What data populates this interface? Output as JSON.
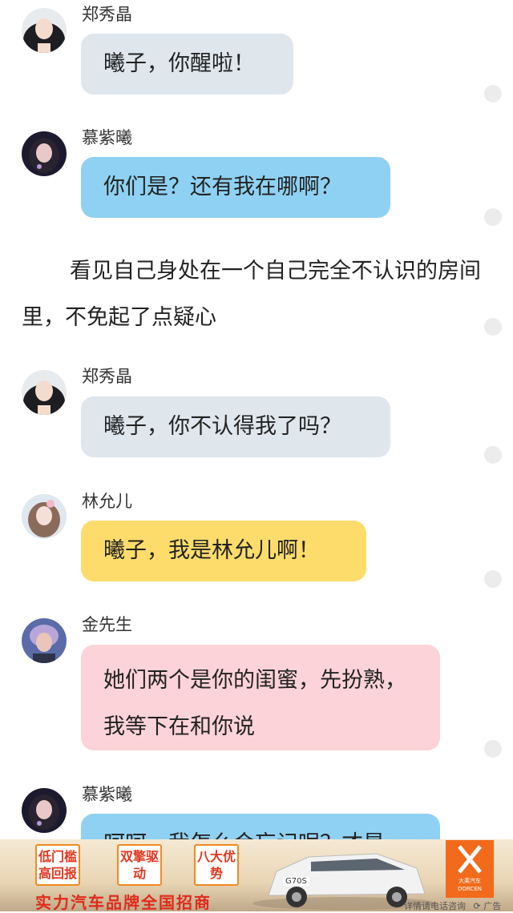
{
  "messages": [
    {
      "name": "郑秀晶",
      "text": "曦子，你醒啦！",
      "color": "#dfe6ec"
    },
    {
      "name": "慕紫曦",
      "text": "你们是？还有我在哪啊？",
      "color": "#8fd1f2"
    },
    {
      "narration": "看见自己身处在一个自己完全不认识的房间里，不免起了点疑心"
    },
    {
      "name": "郑秀晶",
      "text": "曦子，你不认得我了吗？",
      "color": "#dfe6ec"
    },
    {
      "name": "林允儿",
      "text": "曦子，我是林允儿啊！",
      "color": "#fddc6c"
    },
    {
      "name": "金先生",
      "text": "她们两个是你的闺蜜，先扮熟，我等下在和你说",
      "color": "#fcd3d9"
    },
    {
      "name": "慕紫曦",
      "text": "呵呵，我怎么会忘记呢？才是",
      "color": "#8fd1f2"
    }
  ],
  "ad": {
    "badges": [
      "低门槛高回报",
      "双擎驱动",
      "八大优势"
    ],
    "slogan": "实力汽车品牌全国招商",
    "car_plate": "G70S",
    "logo_text": "大乘汽车 DORCEN",
    "footer": "详情请电话咨询",
    "ad_label": "广告"
  }
}
